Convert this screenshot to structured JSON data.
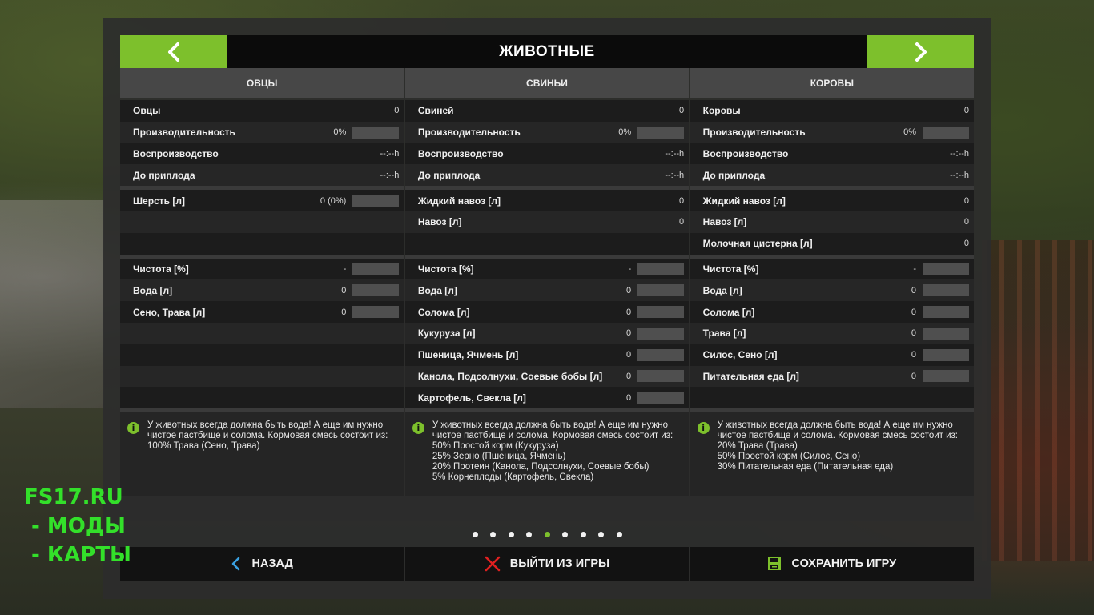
{
  "header": {
    "title": "ЖИВОТНЫЕ"
  },
  "columns": [
    {
      "title": "ОВЦЫ",
      "stats": [
        {
          "label": "Овцы",
          "value": "0"
        },
        {
          "label": "Производительность",
          "value": "0%"
        },
        {
          "label": "Воспроизводство",
          "value": "--:--h"
        },
        {
          "label": "До приплода",
          "value": "--:--h"
        }
      ],
      "products": [
        {
          "label": "Шерсть [л]",
          "value": "0 (0%)"
        },
        {
          "label": "",
          "value": ""
        },
        {
          "label": "",
          "value": ""
        }
      ],
      "needs": [
        {
          "label": "Чистота [%]",
          "value": "-"
        },
        {
          "label": "Вода [л]",
          "value": "0"
        },
        {
          "label": "Сено, Трава [л]",
          "value": "0"
        },
        {
          "label": "",
          "value": ""
        },
        {
          "label": "",
          "value": ""
        },
        {
          "label": "",
          "value": ""
        },
        {
          "label": "",
          "value": ""
        }
      ],
      "info": "У животных всегда должна быть вода! А еще им нужно чистое пастбище и солома. Кормовая смесь состоит из:\n100% Трава (Сено, Трава)"
    },
    {
      "title": "СВИНЬИ",
      "stats": [
        {
          "label": "Свиней",
          "value": "0"
        },
        {
          "label": "Производительность",
          "value": "0%"
        },
        {
          "label": "Воспроизводство",
          "value": "--:--h"
        },
        {
          "label": "До приплода",
          "value": "--:--h"
        }
      ],
      "products": [
        {
          "label": "Жидкий навоз [л]",
          "value": "0"
        },
        {
          "label": "Навоз [л]",
          "value": "0"
        },
        {
          "label": "",
          "value": ""
        }
      ],
      "needs": [
        {
          "label": "Чистота [%]",
          "value": "-"
        },
        {
          "label": "Вода [л]",
          "value": "0"
        },
        {
          "label": "Солома [л]",
          "value": "0"
        },
        {
          "label": "Кукуруза [л]",
          "value": "0"
        },
        {
          "label": "Пшеница, Ячмень [л]",
          "value": "0"
        },
        {
          "label": "Канола, Подсолнухи, Соевые бобы [л]",
          "value": "0"
        },
        {
          "label": "Картофель, Свекла [л]",
          "value": "0"
        }
      ],
      "info": "У животных всегда должна быть вода! А еще им нужно чистое пастбище и солома. Кормовая смесь состоит из:\n50% Простой корм (Кукуруза)\n25% Зерно (Пшеница, Ячмень)\n20% Протеин (Канола, Подсолнухи, Соевые бобы)\n5% Корнеплоды (Картофель, Свекла)"
    },
    {
      "title": "КОРОВЫ",
      "stats": [
        {
          "label": "Коровы",
          "value": "0"
        },
        {
          "label": "Производительность",
          "value": "0%"
        },
        {
          "label": "Воспроизводство",
          "value": "--:--h"
        },
        {
          "label": "До приплода",
          "value": "--:--h"
        }
      ],
      "products": [
        {
          "label": "Жидкий навоз [л]",
          "value": "0"
        },
        {
          "label": "Навоз [л]",
          "value": "0"
        },
        {
          "label": "Молочная цистерна [л]",
          "value": "0"
        }
      ],
      "needs": [
        {
          "label": "Чистота [%]",
          "value": "-"
        },
        {
          "label": "Вода [л]",
          "value": "0"
        },
        {
          "label": "Солома [л]",
          "value": "0"
        },
        {
          "label": "Трава [л]",
          "value": "0"
        },
        {
          "label": "Силос, Сено [л]",
          "value": "0"
        },
        {
          "label": "Питательная еда [л]",
          "value": "0"
        },
        {
          "label": "",
          "value": ""
        }
      ],
      "info": "У животных всегда должна быть вода! А еще им нужно чистое пастбище и солома. Кормовая смесь состоит из:\n20% Трава (Трава)\n50% Простой корм (Силос, Сено)\n30% Питательная еда (Питательная еда)"
    }
  ],
  "pager": {
    "count": 9,
    "active": 4
  },
  "footer": {
    "back_label": "НАЗАД",
    "quit_label": "ВЫЙТИ ИЗ ИГРЫ",
    "save_label": "СОХРАНИТЬ ИГРУ"
  },
  "watermark": [
    "FS17.RU",
    " - МОДЫ",
    " - КАРТЫ"
  ],
  "colors": {
    "accent": "#7dc02c",
    "watermark": "#33e02a",
    "quit_icon": "#e02020",
    "back_icon": "#3aa0e0"
  },
  "icons": {
    "prev": "chevron-left-icon",
    "next": "chevron-right-icon",
    "info": "info-icon",
    "back": "back-arrow-icon",
    "quit": "close-x-icon",
    "save": "floppy-disk-icon"
  }
}
